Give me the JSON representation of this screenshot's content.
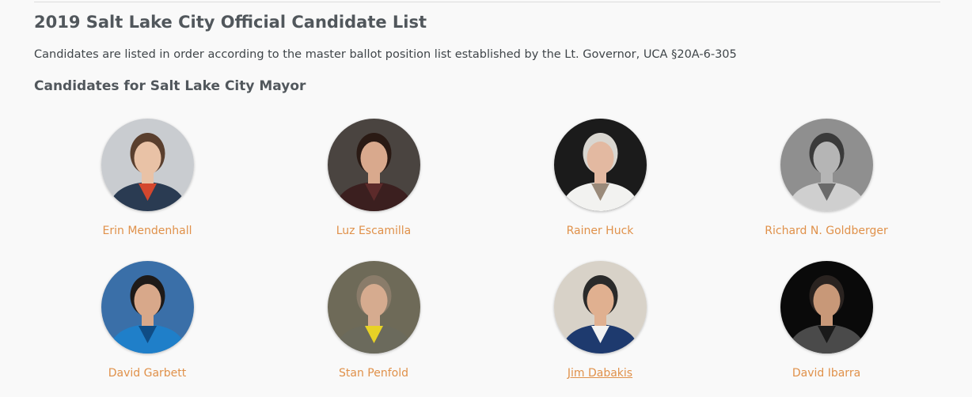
{
  "page": {
    "title": "2019 Salt Lake City Official Candidate List",
    "intro": "Candidates are listed in order according to the master ballot position list established by the Lt. Governor, UCA §20A-6-305",
    "section_title": "Candidates for Salt Lake City Mayor"
  },
  "candidates": [
    {
      "name": "Erin Mendenhall",
      "photo_bg": "#c9ccd0",
      "hair": "#5a3f2e",
      "skin": "#e9c2a6",
      "shirt": "#2a3b52",
      "accent": "#d4472e",
      "grayscale": false
    },
    {
      "name": "Luz Escamilla",
      "photo_bg": "#4a4440",
      "hair": "#2a1a14",
      "skin": "#d9a98d",
      "shirt": "#3b1f1f",
      "accent": "#5c2a2a",
      "grayscale": false
    },
    {
      "name": "Rainer Huck",
      "photo_bg": "#1b1b1b",
      "hair": "#d9d6d0",
      "skin": "#e3b9a1",
      "shirt": "#f2f2f0",
      "accent": "#9a8a7a",
      "grayscale": false
    },
    {
      "name": "Richard N. Goldberger",
      "photo_bg": "#8f8f8f",
      "hair": "#3a3a3a",
      "skin": "#b5b5b5",
      "shirt": "#cfcfcf",
      "accent": "#6a6a6a",
      "grayscale": true
    },
    {
      "name": "David Garbett",
      "photo_bg": "#3a6fa8",
      "hair": "#1e1a18",
      "skin": "#d8a88a",
      "shirt": "#1f7fc9",
      "accent": "#0f4c85",
      "grayscale": false
    },
    {
      "name": "Stan Penfold",
      "photo_bg": "#6e6a58",
      "hair": "#8a7c6a",
      "skin": "#d6ab8f",
      "shirt": "#6b6a5c",
      "accent": "#e8d226",
      "grayscale": false
    },
    {
      "name": "Jim Dabakis",
      "photo_bg": "#d8d2c8",
      "hair": "#2a2a2a",
      "skin": "#e0b090",
      "shirt": "#1e3a6e",
      "accent": "#f2f2f2",
      "grayscale": false
    },
    {
      "name": "David Ibarra",
      "photo_bg": "#0a0a0a",
      "hair": "#2a2320",
      "skin": "#c89878",
      "shirt": "#4a4a4a",
      "accent": "#1a1a1a",
      "grayscale": false
    }
  ],
  "colors": {
    "link": "#e0914a",
    "heading": "#51575c",
    "background": "#f9f9f9"
  }
}
